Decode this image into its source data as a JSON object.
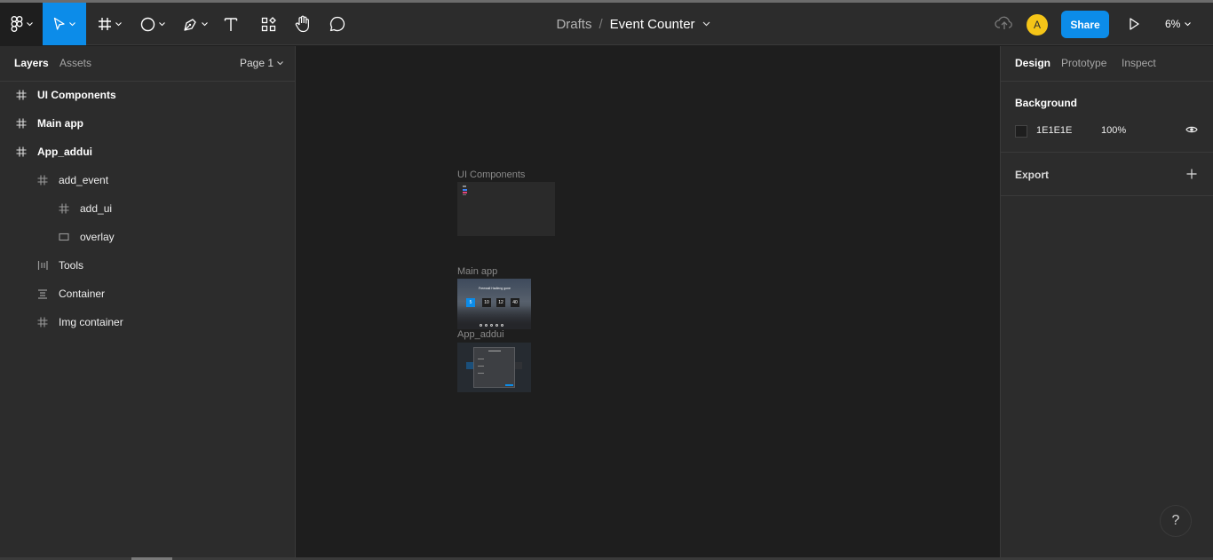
{
  "toolbar": {
    "tools": [
      {
        "name": "main-menu",
        "icon": "figma-logo-icon"
      },
      {
        "name": "move",
        "icon": "cursor-arrow-icon"
      },
      {
        "name": "frame",
        "icon": "frame-hash-icon"
      },
      {
        "name": "shape",
        "icon": "ellipse-icon"
      },
      {
        "name": "pen",
        "icon": "pen-icon"
      },
      {
        "name": "text",
        "icon": "text-icon"
      },
      {
        "name": "resources",
        "icon": "components-icon"
      },
      {
        "name": "hand",
        "icon": "hand-icon"
      },
      {
        "name": "comment",
        "icon": "comment-icon"
      }
    ],
    "breadcrumb": {
      "project": "Drafts",
      "separator": "/",
      "file_name": "Event Counter"
    },
    "avatar_initial": "A",
    "share_label": "Share",
    "zoom_label": "6%",
    "accent_color": "#0c8ce9",
    "avatar_color": "#f5c518"
  },
  "left_panel": {
    "tabs": {
      "layers": "Layers",
      "assets": "Assets"
    },
    "page_label": "Page 1",
    "layers": [
      {
        "label": "UI Components",
        "icon": "frame-hash-icon",
        "depth": 0
      },
      {
        "label": "Main app",
        "icon": "frame-hash-icon",
        "depth": 0
      },
      {
        "label": "App_addui",
        "icon": "frame-hash-icon",
        "depth": 0
      },
      {
        "label": "add_event",
        "icon": "frame-hash-icon",
        "depth": 1
      },
      {
        "label": "add_ui",
        "icon": "frame-hash-icon",
        "depth": 2
      },
      {
        "label": "overlay",
        "icon": "rectangle-icon",
        "depth": 2
      },
      {
        "label": "Tools",
        "icon": "horizontal-auto-layout-icon",
        "depth": 1
      },
      {
        "label": "Container",
        "icon": "vertical-auto-layout-icon",
        "depth": 1
      },
      {
        "label": "Img container",
        "icon": "frame-hash-icon",
        "depth": 1
      }
    ]
  },
  "canvas": {
    "frames": [
      {
        "label": "UI Components"
      },
      {
        "label": "Main app"
      },
      {
        "label": "App_addui"
      }
    ],
    "main_app_counter": {
      "heading": "Freewall Hadleng gone",
      "values": [
        "5",
        "10",
        "12",
        "40"
      ]
    }
  },
  "right_panel": {
    "tabs": {
      "design": "Design",
      "prototype": "Prototype",
      "inspect": "Inspect"
    },
    "background": {
      "title": "Background",
      "hex": "1E1E1E",
      "opacity": "100%",
      "color": "#1e1e1e"
    },
    "export": {
      "title": "Export"
    }
  },
  "help_label": "?"
}
